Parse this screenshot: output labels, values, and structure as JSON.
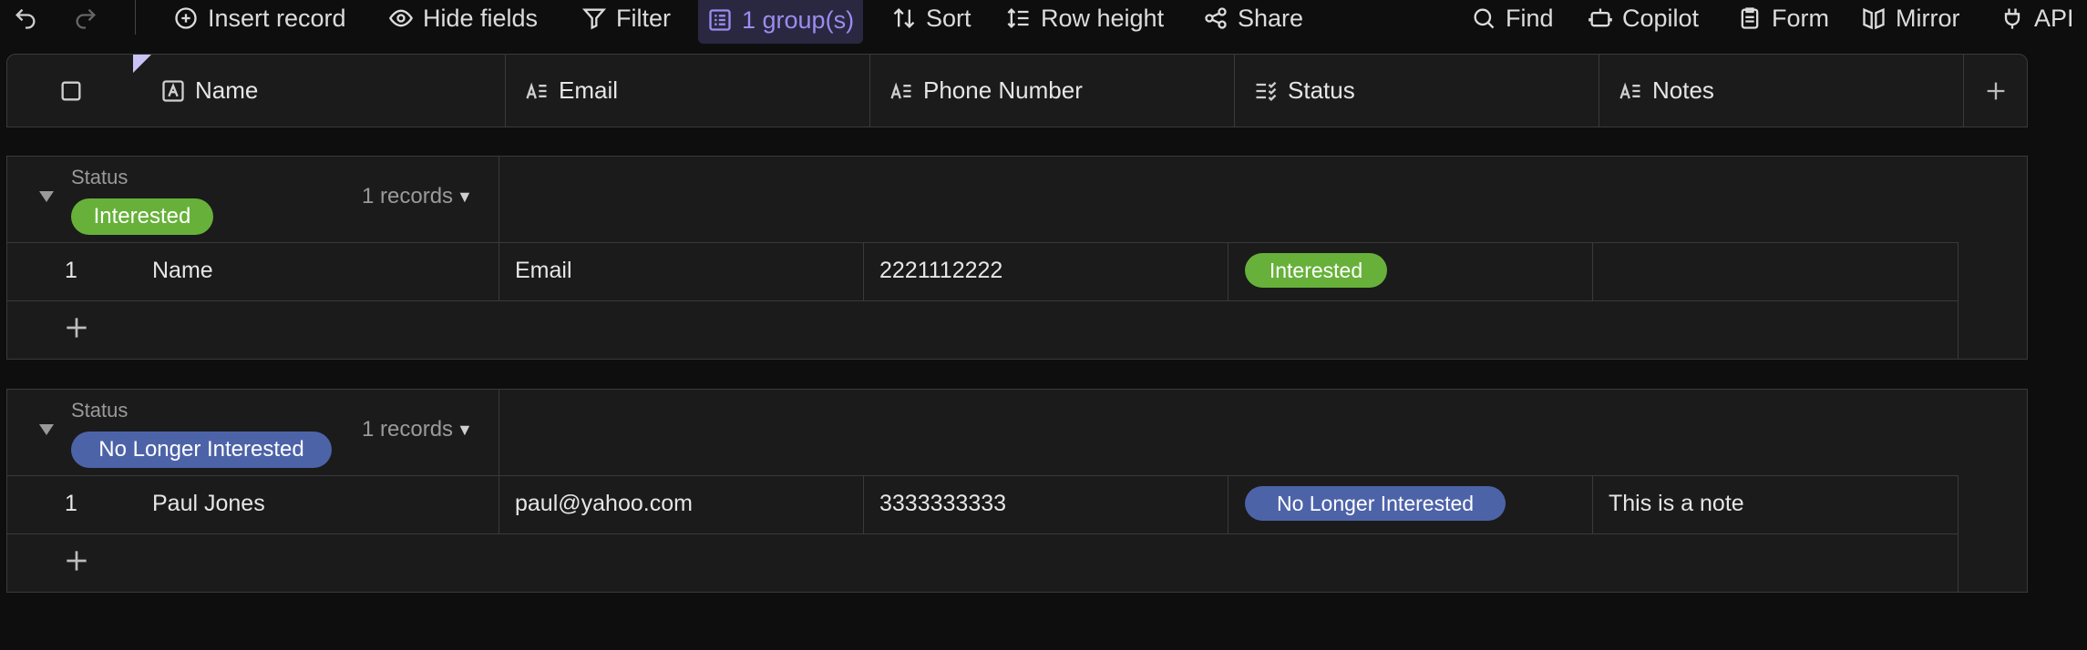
{
  "toolbar": {
    "insert_record": "Insert record",
    "hide_fields": "Hide fields",
    "filter": "Filter",
    "group": "1 group(s)",
    "sort": "Sort",
    "row_height": "Row height",
    "share": "Share",
    "find": "Find",
    "copilot": "Copilot",
    "form": "Form",
    "mirror": "Mirror",
    "api": "API"
  },
  "columns": [
    "Name",
    "Email",
    "Phone Number",
    "Status",
    "Notes"
  ],
  "groups": [
    {
      "field_label": "Status",
      "value": "Interested",
      "count": "1 records",
      "rows": [
        {
          "index": "1",
          "name": "Name",
          "email": "Email",
          "phone": "2221112222",
          "status": "Interested",
          "notes": ""
        }
      ]
    },
    {
      "field_label": "Status",
      "value": "No Longer Interested",
      "count": "1 records",
      "rows": [
        {
          "index": "1",
          "name": "Paul Jones",
          "email": "paul@yahoo.com",
          "phone": "3333333333",
          "status": "No Longer Interested",
          "notes": "This is a note"
        }
      ]
    }
  ],
  "colors": {
    "interested": "#67b13a",
    "no_longer_interested": "#4d63a8",
    "accent": "#9a8df0"
  }
}
